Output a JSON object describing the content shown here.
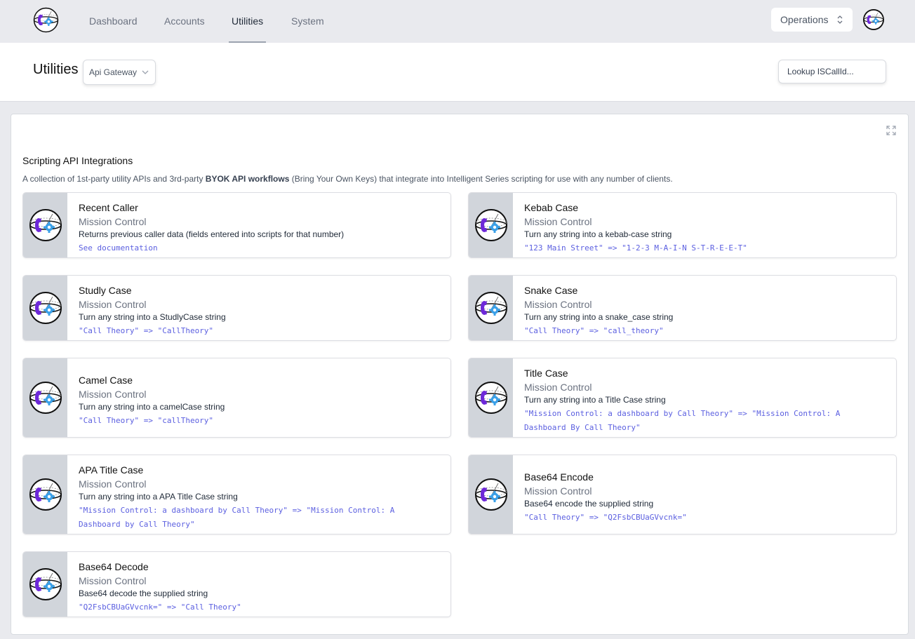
{
  "nav": {
    "items": [
      {
        "label": "Dashboard",
        "active": false
      },
      {
        "label": "Accounts",
        "active": false
      },
      {
        "label": "Utilities",
        "active": true
      },
      {
        "label": "System",
        "active": false
      }
    ],
    "operations_select": "Operations"
  },
  "header": {
    "title": "Utilities",
    "gateway_select": "Api Gateway",
    "lookup_placeholder": "Lookup ISCallId..."
  },
  "section": {
    "title": "Scripting API Integrations",
    "desc_pre": "A collection of 1st-party utility APIs and 3rd-party ",
    "desc_bold": "BYOK API workflows",
    "desc_post": " (Bring Your Own Keys) that integrate into Intelligent Series scripting for use with any number of clients."
  },
  "colors": {
    "accent": "#5b5fe0",
    "phone": "#6d28d9",
    "gear": "#3aa0e8",
    "card_side": "#d1d5db"
  },
  "cards": [
    {
      "title": "Recent Caller",
      "subtitle": "Mission Control",
      "desc": "Returns previous caller data (fields entered into scripts for that number)",
      "example": "See documentation"
    },
    {
      "title": "Kebab Case",
      "subtitle": "Mission Control",
      "desc": "Turn any string into a kebab-case string",
      "example": "\"123 Main Street\" => \"1-2-3 M-A-I-N S-T-R-E-E-T\""
    },
    {
      "title": "Studly Case",
      "subtitle": "Mission Control",
      "desc": "Turn any string into a StudlyCase string",
      "example": "\"Call Theory\" => \"CallTheory\""
    },
    {
      "title": "Snake Case",
      "subtitle": "Mission Control",
      "desc": "Turn any string into a snake_case string",
      "example": "\"Call Theory\" => \"call_theory\""
    },
    {
      "title": "Camel Case",
      "subtitle": "Mission Control",
      "desc": "Turn any string into a camelCase string",
      "example": "\"Call Theory\" => \"callTheory\""
    },
    {
      "title": "Title Case",
      "subtitle": "Mission Control",
      "desc": "Turn any string into a Title Case string",
      "example": "\"Mission Control: a dashboard by Call Theory\" => \"Mission Control: A Dashboard By Call Theory\""
    },
    {
      "title": "APA Title Case",
      "subtitle": "Mission Control",
      "desc": "Turn any string into a APA Title Case string",
      "example": "\"Mission Control: a dashboard by Call Theory\" => \"Mission Control: A Dashboard by Call Theory\""
    },
    {
      "title": "Base64 Encode",
      "subtitle": "Mission Control",
      "desc": "Base64 encode the supplied string",
      "example": "\"Call Theory\" => \"Q2FsbCBUaGVvcnk=\""
    },
    {
      "title": "Base64 Decode",
      "subtitle": "Mission Control",
      "desc": "Base64 decode the supplied string",
      "example": "\"Q2FsbCBUaGVvcnk=\" => \"Call Theory\""
    }
  ]
}
